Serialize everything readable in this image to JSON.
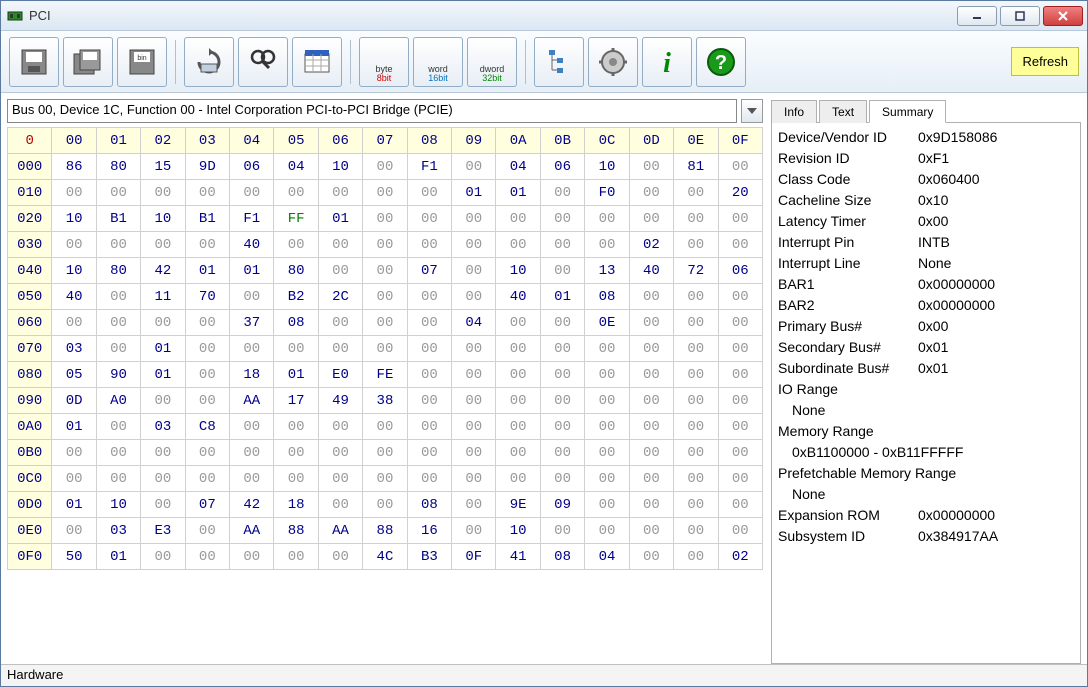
{
  "window": {
    "title": "PCI"
  },
  "toolbar": {
    "byte": {
      "top": "byte",
      "bot": "8bit"
    },
    "word": {
      "top": "word",
      "bot": "16bit"
    },
    "dword": {
      "top": "dword",
      "bot": "32bit"
    },
    "refresh": "Refresh"
  },
  "device_select": "Bus 00, Device 1C, Function 00 - Intel Corporation PCI-to-PCI Bridge (PCIE)",
  "hex": {
    "corner": "0",
    "cols": [
      "00",
      "01",
      "02",
      "03",
      "04",
      "05",
      "06",
      "07",
      "08",
      "09",
      "0A",
      "0B",
      "0C",
      "0D",
      "0E",
      "0F"
    ],
    "rows": [
      {
        "hdr": "000",
        "cells": [
          "86",
          "80",
          "15",
          "9D",
          "06",
          "04",
          "10",
          "00",
          "F1",
          "00",
          "04",
          "06",
          "10",
          "00",
          "81",
          "00"
        ]
      },
      {
        "hdr": "010",
        "cells": [
          "00",
          "00",
          "00",
          "00",
          "00",
          "00",
          "00",
          "00",
          "00",
          "01",
          "01",
          "00",
          "F0",
          "00",
          "00",
          "20"
        ]
      },
      {
        "hdr": "020",
        "cells": [
          "10",
          "B1",
          "10",
          "B1",
          "F1",
          "FF",
          "01",
          "00",
          "00",
          "00",
          "00",
          "00",
          "00",
          "00",
          "00",
          "00"
        ]
      },
      {
        "hdr": "030",
        "cells": [
          "00",
          "00",
          "00",
          "00",
          "40",
          "00",
          "00",
          "00",
          "00",
          "00",
          "00",
          "00",
          "00",
          "02",
          "00",
          "00"
        ]
      },
      {
        "hdr": "040",
        "cells": [
          "10",
          "80",
          "42",
          "01",
          "01",
          "80",
          "00",
          "00",
          "07",
          "00",
          "10",
          "00",
          "13",
          "40",
          "72",
          "06"
        ]
      },
      {
        "hdr": "050",
        "cells": [
          "40",
          "00",
          "11",
          "70",
          "00",
          "B2",
          "2C",
          "00",
          "00",
          "00",
          "40",
          "01",
          "08",
          "00",
          "00",
          "00"
        ]
      },
      {
        "hdr": "060",
        "cells": [
          "00",
          "00",
          "00",
          "00",
          "37",
          "08",
          "00",
          "00",
          "00",
          "04",
          "00",
          "00",
          "0E",
          "00",
          "00",
          "00"
        ]
      },
      {
        "hdr": "070",
        "cells": [
          "03",
          "00",
          "01",
          "00",
          "00",
          "00",
          "00",
          "00",
          "00",
          "00",
          "00",
          "00",
          "00",
          "00",
          "00",
          "00"
        ]
      },
      {
        "hdr": "080",
        "cells": [
          "05",
          "90",
          "01",
          "00",
          "18",
          "01",
          "E0",
          "FE",
          "00",
          "00",
          "00",
          "00",
          "00",
          "00",
          "00",
          "00"
        ]
      },
      {
        "hdr": "090",
        "cells": [
          "0D",
          "A0",
          "00",
          "00",
          "AA",
          "17",
          "49",
          "38",
          "00",
          "00",
          "00",
          "00",
          "00",
          "00",
          "00",
          "00"
        ]
      },
      {
        "hdr": "0A0",
        "cells": [
          "01",
          "00",
          "03",
          "C8",
          "00",
          "00",
          "00",
          "00",
          "00",
          "00",
          "00",
          "00",
          "00",
          "00",
          "00",
          "00"
        ]
      },
      {
        "hdr": "0B0",
        "cells": [
          "00",
          "00",
          "00",
          "00",
          "00",
          "00",
          "00",
          "00",
          "00",
          "00",
          "00",
          "00",
          "00",
          "00",
          "00",
          "00"
        ]
      },
      {
        "hdr": "0C0",
        "cells": [
          "00",
          "00",
          "00",
          "00",
          "00",
          "00",
          "00",
          "00",
          "00",
          "00",
          "00",
          "00",
          "00",
          "00",
          "00",
          "00"
        ]
      },
      {
        "hdr": "0D0",
        "cells": [
          "01",
          "10",
          "00",
          "07",
          "42",
          "18",
          "00",
          "00",
          "08",
          "00",
          "9E",
          "09",
          "00",
          "00",
          "00",
          "00"
        ]
      },
      {
        "hdr": "0E0",
        "cells": [
          "00",
          "03",
          "E3",
          "00",
          "AA",
          "88",
          "AA",
          "88",
          "16",
          "00",
          "10",
          "00",
          "00",
          "00",
          "00",
          "00"
        ]
      },
      {
        "hdr": "0F0",
        "cells": [
          "50",
          "01",
          "00",
          "00",
          "00",
          "00",
          "00",
          "4C",
          "B3",
          "0F",
          "41",
          "08",
          "04",
          "00",
          "00",
          "02"
        ]
      }
    ]
  },
  "tabs": {
    "info": "Info",
    "text": "Text",
    "summary": "Summary"
  },
  "summary": [
    {
      "label": "Device/Vendor ID",
      "value": "0x9D158086"
    },
    {
      "label": "Revision ID",
      "value": "0xF1"
    },
    {
      "label": "Class Code",
      "value": "0x060400"
    },
    {
      "label": "Cacheline Size",
      "value": "0x10"
    },
    {
      "label": "Latency Timer",
      "value": "0x00"
    },
    {
      "label": "Interrupt Pin",
      "value": "INTB"
    },
    {
      "label": "Interrupt Line",
      "value": "None"
    },
    {
      "label": "BAR1",
      "value": "0x00000000"
    },
    {
      "label": "BAR2",
      "value": "0x00000000"
    },
    {
      "label": "Primary Bus#",
      "value": "0x00"
    },
    {
      "label": "Secondary Bus#",
      "value": "0x01"
    },
    {
      "label": "Subordinate Bus#",
      "value": "0x01"
    },
    {
      "label": "IO Range",
      "value": ""
    },
    {
      "label": "",
      "value": "None",
      "indent": true
    },
    {
      "label": "Memory Range",
      "value": ""
    },
    {
      "label": "",
      "value": "0xB1100000 - 0xB11FFFFF",
      "indent": true
    },
    {
      "label": "Prefetchable Memory Range",
      "value": "",
      "wide": true
    },
    {
      "label": "",
      "value": "None",
      "indent": true
    },
    {
      "label": "Expansion ROM",
      "value": "0x00000000"
    },
    {
      "label": "Subsystem ID",
      "value": "0x384917AA"
    }
  ],
  "statusbar": "Hardware"
}
